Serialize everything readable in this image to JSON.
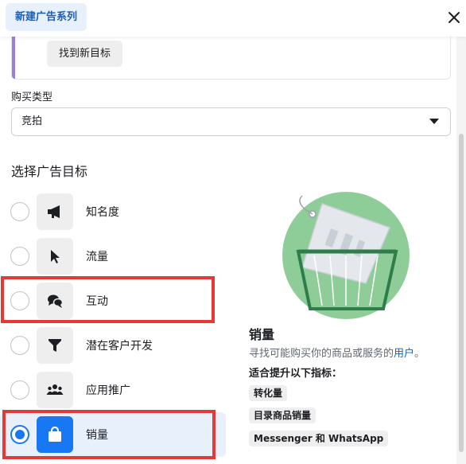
{
  "header": {
    "tab_label": "新建广告系列",
    "close_icon": "close-icon"
  },
  "goal_card": {
    "button_label": "找到新目标"
  },
  "buy_type": {
    "label": "购买类型",
    "selected": "竞拍"
  },
  "objective": {
    "title": "选择广告目标",
    "options": [
      {
        "label": "知名度",
        "icon": "megaphone-icon",
        "selected": false
      },
      {
        "label": "流量",
        "icon": "cursor-icon",
        "selected": false
      },
      {
        "label": "互动",
        "icon": "chat-bubbles-icon",
        "selected": false
      },
      {
        "label": "潜在客户开发",
        "icon": "funnel-icon",
        "selected": false
      },
      {
        "label": "应用推广",
        "icon": "people-icon",
        "selected": false
      },
      {
        "label": "销量",
        "icon": "shopping-bag-icon",
        "selected": true
      }
    ]
  },
  "details": {
    "title": "销量",
    "description": "寻找可能购买你的商品或服务的",
    "description_link": "用户",
    "description_end": "。",
    "metrics_title": "适合提升以下指标：",
    "metrics": [
      "转化量",
      "目录商品销量",
      "Messenger 和 WhatsApp"
    ]
  },
  "colors": {
    "accent": "#1877f2",
    "highlight_box": "#e53935",
    "illustration_green": "#8fcd98"
  }
}
